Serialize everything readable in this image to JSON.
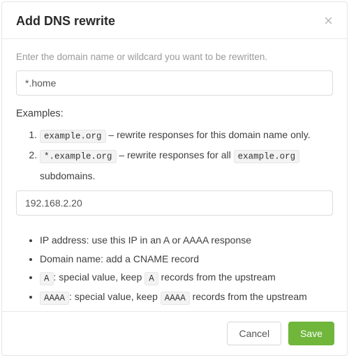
{
  "modal": {
    "title": "Add DNS rewrite",
    "close_label": "×"
  },
  "form": {
    "domain_helper": "Enter the domain name or wildcard you want to be rewritten.",
    "domain_value": "*.home",
    "answer_value": "192.168.2.20"
  },
  "examples": {
    "label": "Examples:",
    "items": [
      {
        "code": "example.org",
        "text": " – rewrite responses for this domain name only."
      },
      {
        "code": "*.example.org",
        "text_before": " – rewrite responses for all ",
        "inline_code": "example.org",
        "text_after": " subdomains."
      }
    ]
  },
  "notes": [
    {
      "text": "IP address: use this IP in an A or AAAA response"
    },
    {
      "text": "Domain name: add a CNAME record"
    },
    {
      "code": "A",
      "before": "",
      "after": ": special value, keep ",
      "code2": "A",
      "after2": " records from the upstream"
    },
    {
      "code": "AAAA",
      "before": "",
      "after": ": special value, keep ",
      "code2": "AAAA",
      "after2": " records from the upstream"
    }
  ],
  "footer": {
    "cancel": "Cancel",
    "save": "Save"
  }
}
